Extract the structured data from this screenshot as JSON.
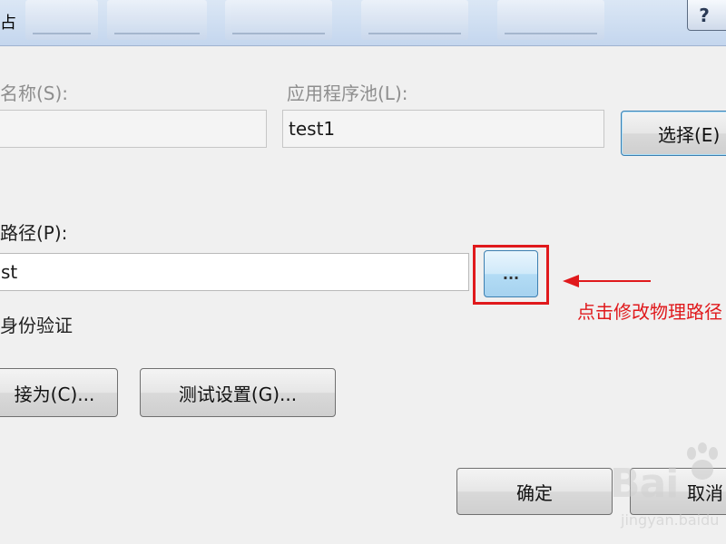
{
  "window": {
    "title_fragment": "占",
    "help_label": "?"
  },
  "site_name": {
    "label": "名称(S):",
    "value": ""
  },
  "app_pool": {
    "label": "应用程序池(L):",
    "value": "test1",
    "select_button": "选择(E)"
  },
  "physical_path": {
    "label": "路径(P):",
    "value": "st",
    "browse_button": "..."
  },
  "pass_through": {
    "label": "身份验证"
  },
  "buttons": {
    "connect_as": "接为(C)...",
    "test_settings": "测试设置(G)...",
    "ok": "确定",
    "cancel": "取消"
  },
  "annotation": {
    "text": "点击修改物理路径",
    "color": "#e0191c"
  },
  "watermark": {
    "brand": "Bai",
    "sub": "jingyan.baidu"
  }
}
